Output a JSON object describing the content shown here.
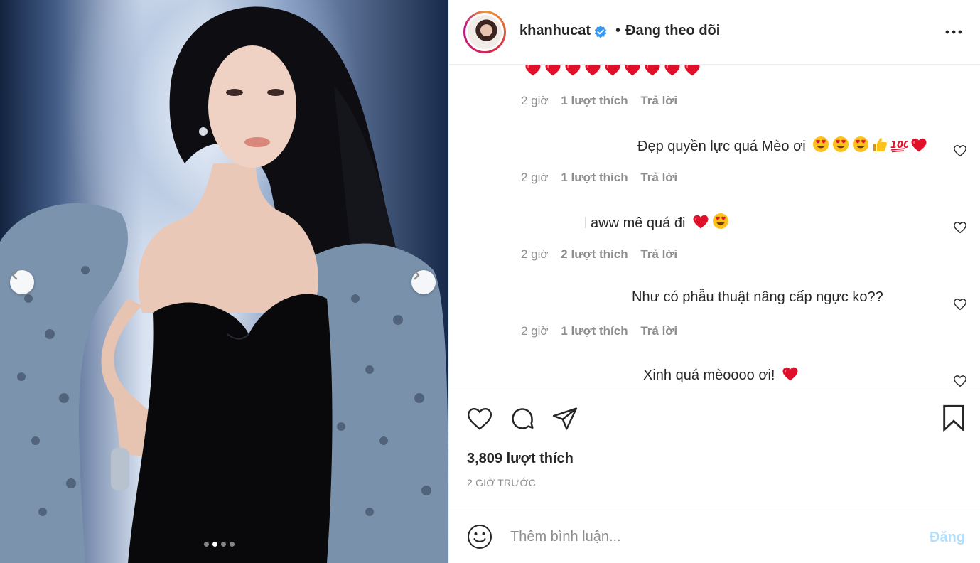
{
  "media": {
    "carousel_index": 2,
    "carousel_total": 4,
    "alt": "Photo"
  },
  "header": {
    "username": "khanhucat",
    "bullet": "•",
    "follow_state": "Đang theo dõi",
    "verified": true
  },
  "comments": [
    {
      "text": "",
      "emojis": [
        "heart",
        "heart",
        "heart",
        "heart",
        "heart",
        "heart",
        "heart",
        "heart",
        "heart"
      ],
      "time": "2 giờ",
      "likes": "1 lượt thích",
      "reply": "Trả lời"
    },
    {
      "text": "Đẹp quyền lực quá Mèo ơi",
      "emojis": [
        "heart-eyes",
        "heart-eyes",
        "heart-eyes",
        "thumbs-up",
        "hundred",
        "heart"
      ],
      "time": "2 giờ",
      "likes": "1 lượt thích",
      "reply": "Trả lời"
    },
    {
      "text": "aww mê quá đi",
      "emojis": [
        "heart",
        "heart-eyes"
      ],
      "time": "2 giờ",
      "likes": "2 lượt thích",
      "reply": "Trả lời"
    },
    {
      "text": "Như có phẫu thuật nâng cấp ngực ko??",
      "emojis": [],
      "time": "2 giờ",
      "likes": "1 lượt thích",
      "reply": "Trả lời"
    },
    {
      "text": "Xinh quá mèoooo ơi!",
      "emojis": [
        "heart"
      ],
      "time": "",
      "likes": "",
      "reply": ""
    }
  ],
  "post": {
    "likes": "3,809 lượt thích",
    "time": "2 GIỜ TRƯỚC"
  },
  "composer": {
    "placeholder": "Thêm bình luận...",
    "post_label": "Đăng",
    "post_color": "#b2dffc"
  },
  "colors": {
    "text": "#262626",
    "secondary": "#8e8e8e",
    "verified": "#3897f0",
    "heart": "#e0102a"
  },
  "icons": [
    "chevron-left-icon",
    "chevron-right-icon",
    "verified-icon",
    "more-icon",
    "heart-outline-icon",
    "comment-icon",
    "share-icon",
    "bookmark-icon",
    "smiley-icon"
  ]
}
